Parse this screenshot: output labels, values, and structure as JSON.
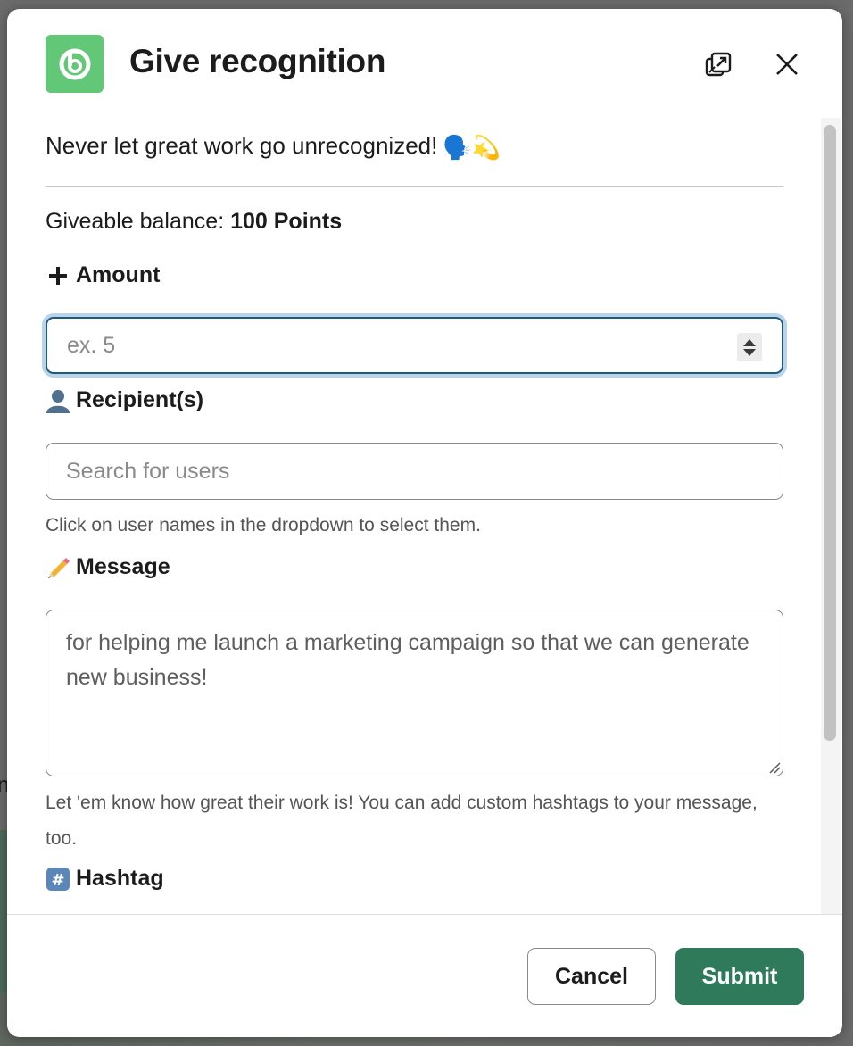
{
  "modal": {
    "title": "Give recognition",
    "brand_color": "#62c776",
    "icons": {
      "app": "bonusly-logo-icon",
      "popout": "popout-window-icon",
      "close": "close-icon"
    }
  },
  "intro": {
    "text": "Never let great work go unrecognized!",
    "emoji": "🗣️💫"
  },
  "balance": {
    "label": "Giveable balance:",
    "value": "100 Points"
  },
  "amount": {
    "icon": "plus-icon",
    "label": "Amount",
    "placeholder": "ex. 5"
  },
  "recipients": {
    "icon": "user-silhouette-icon",
    "label": "Recipient(s)",
    "placeholder": "Search for users",
    "hint": "Click on user names in the dropdown to select them."
  },
  "message": {
    "icon": "pencil-icon",
    "label": "Message",
    "value": "for helping me launch a marketing campaign so that we can generate new business!",
    "hint": "Let 'em know how great their work is! You can add custom hashtags to your message, too."
  },
  "hashtag": {
    "icon": "hash-keycap-icon",
    "label": "Hashtag"
  },
  "footer": {
    "cancel_label": "Cancel",
    "submit_label": "Submit",
    "submit_color": "#2f7a5b"
  }
}
